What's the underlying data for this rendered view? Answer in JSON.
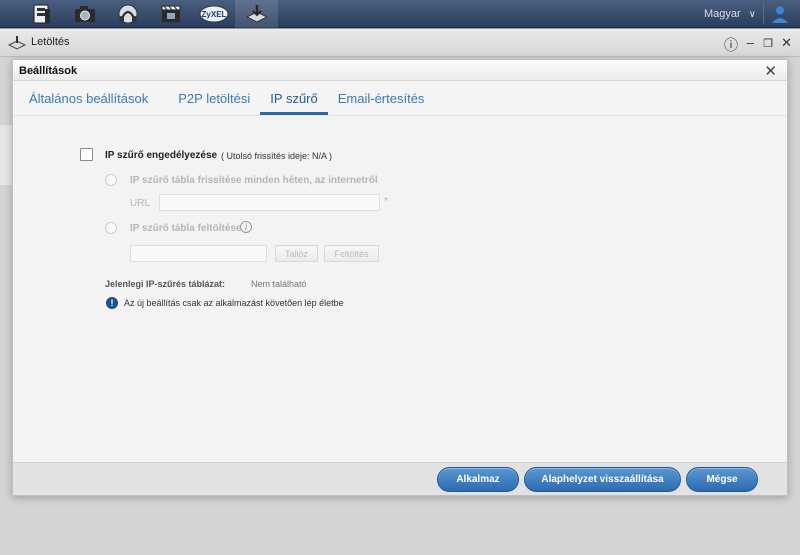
{
  "taskbar": {
    "apps": [
      {
        "icon": "storage-manager-icon"
      },
      {
        "icon": "photo-camera-icon"
      },
      {
        "icon": "music-player-icon"
      },
      {
        "icon": "video-film-icon"
      },
      {
        "icon": "zyxel-logo-icon",
        "text": "ZyXEL"
      },
      {
        "icon": "download-service-icon"
      }
    ],
    "language": "Magyar",
    "user_icon": "user-icon"
  },
  "app_window": {
    "title": "Letöltés",
    "help_icon": "help-icon",
    "minimize_icon": "minimize-icon",
    "restore_icon": "restore-icon",
    "close_icon": "close-icon"
  },
  "dialog": {
    "title": "Beállítások",
    "close_icon": "close-icon",
    "tabs": [
      {
        "label": "Általános beállítások"
      },
      {
        "label": "P2P letöltési"
      },
      {
        "label": "IP szűrő",
        "active": true
      },
      {
        "label": "Email-értesítés"
      }
    ],
    "ip_filter": {
      "enable_label": "IP szűrő engedélyezése",
      "last_update": "( Utolsó frissítés ideje: N/A )",
      "weekly_update_label": "IP szűrő tábla frissítése minden héten, az internetről",
      "url_label": "URL",
      "url_value": "",
      "url_required_mark": "*",
      "upload_label": "IP szűrő tábla feltöltése",
      "upload_file_value": "",
      "browse_button": "Tallóz",
      "upload_button": "Feltöltés",
      "current_table_label": "Jelenlegi IP-szűrés táblázat:",
      "current_table_value": "Nem található",
      "notice": "Az új beállítás csak az alkalmazást követően lép életbe"
    },
    "footer": {
      "apply": "Alkalmaz",
      "reset": "Alaphelyzet visszaállítása",
      "cancel": "Mégse"
    }
  }
}
